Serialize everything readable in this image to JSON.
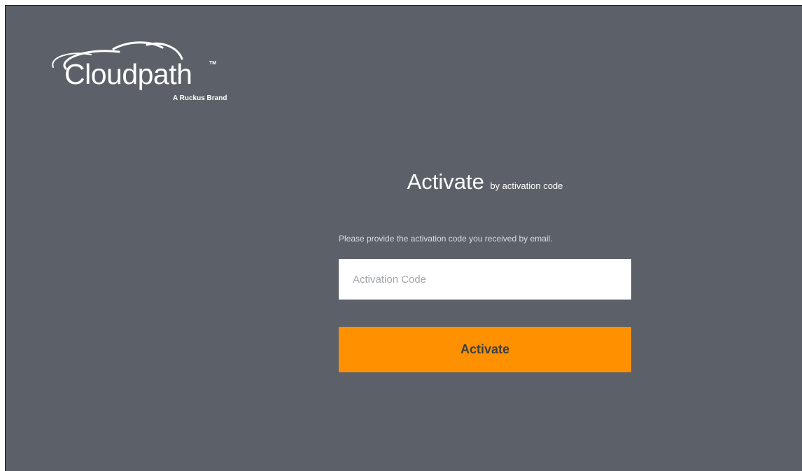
{
  "logo": {
    "wordmark": "Cloudpath",
    "trademark": "TM",
    "tagline": "A Ruckus Brand",
    "icon": "cloud-swoosh-icon"
  },
  "heading": {
    "main": "Activate",
    "sub": "by activation code"
  },
  "instructions": "Please provide the activation code you received by email.",
  "activation_input": {
    "value": "",
    "placeholder": "Activation Code"
  },
  "activate_button": {
    "label": "Activate"
  },
  "colors": {
    "background": "#5c6169",
    "accent": "#ff9100",
    "text": "#ffffff"
  }
}
